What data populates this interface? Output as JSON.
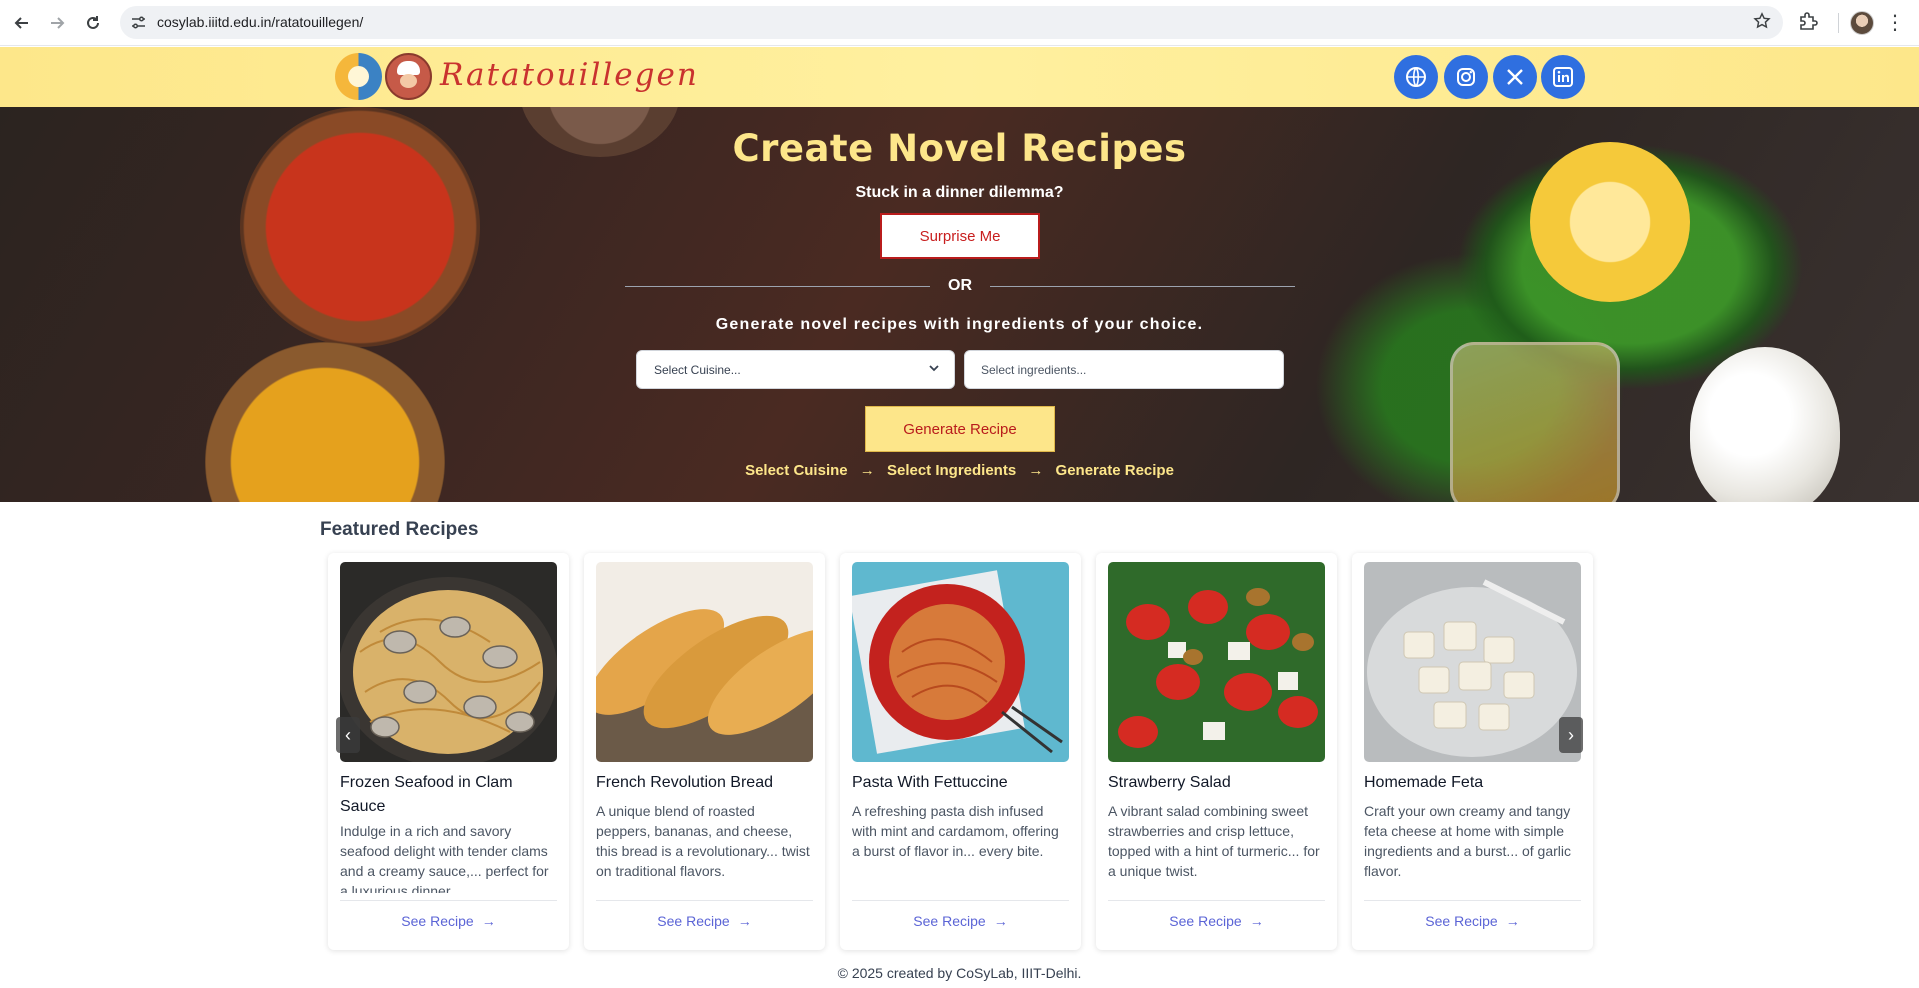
{
  "browser": {
    "url": "cosylab.iiitd.edu.in/ratatouillegen/",
    "back_icon": "arrow-left",
    "forward_icon": "arrow-right",
    "reload_icon": "reload",
    "site_info_icon": "tune",
    "bookmark_icon": "star-outline",
    "extensions_icon": "puzzle",
    "menu_icon": "kebab"
  },
  "header": {
    "brand": "Ratatouillegen",
    "social": [
      {
        "name": "website",
        "icon": "globe"
      },
      {
        "name": "instagram",
        "icon": "instagram"
      },
      {
        "name": "x",
        "icon": "x"
      },
      {
        "name": "linkedin",
        "icon": "linkedin"
      }
    ],
    "accent": "#fde68a",
    "brand_color": "#c9322f",
    "social_color": "#2f6fe0"
  },
  "hero": {
    "title": "Create Novel Recipes",
    "subtitle": "Stuck in a dinner dilemma?",
    "surprise_label": "Surprise Me",
    "or_label": "OR",
    "generate_text": "Generate novel recipes with ingredients of your choice.",
    "cuisine_select": "Select Cuisine...",
    "ingredients_placeholder": "Select ingredients...",
    "generate_button": "Generate Recipe",
    "steps": [
      "Select Cuisine",
      "Select Ingredients",
      "Generate Recipe"
    ],
    "step_separator": "→"
  },
  "featured": {
    "title": "Featured Recipes",
    "link_label": "See Recipe",
    "link_arrow": "→",
    "prev_icon": "‹",
    "next_icon": "›",
    "cards": [
      {
        "title": "Frozen Seafood in Clam Sauce",
        "description": "Indulge in a rich and savory seafood delight with tender clams and a creamy sauce,... perfect for a luxurious dinner.",
        "image": "clam-pasta"
      },
      {
        "title": "French Revolution Bread",
        "description": "A unique blend of roasted peppers, bananas, and cheese, this bread is a revolutionary... twist on traditional flavors.",
        "image": "baguettes"
      },
      {
        "title": "Pasta With Fettuccine",
        "description": "A refreshing pasta dish infused with mint and cardamom, offering a burst of flavor in... every bite.",
        "image": "fettuccine"
      },
      {
        "title": "Strawberry Salad",
        "description": "A vibrant salad combining sweet strawberries and crisp lettuce, topped with a hint of turmeric... for a unique twist.",
        "image": "strawberry-salad"
      },
      {
        "title": "Homemade Feta",
        "description": "Craft your own creamy and tangy feta cheese at home with simple ingredients and a burst... of garlic flavor.",
        "image": "feta"
      }
    ]
  },
  "footer": {
    "text": "© 2025 created by CoSyLab, IIIT-Delhi."
  }
}
